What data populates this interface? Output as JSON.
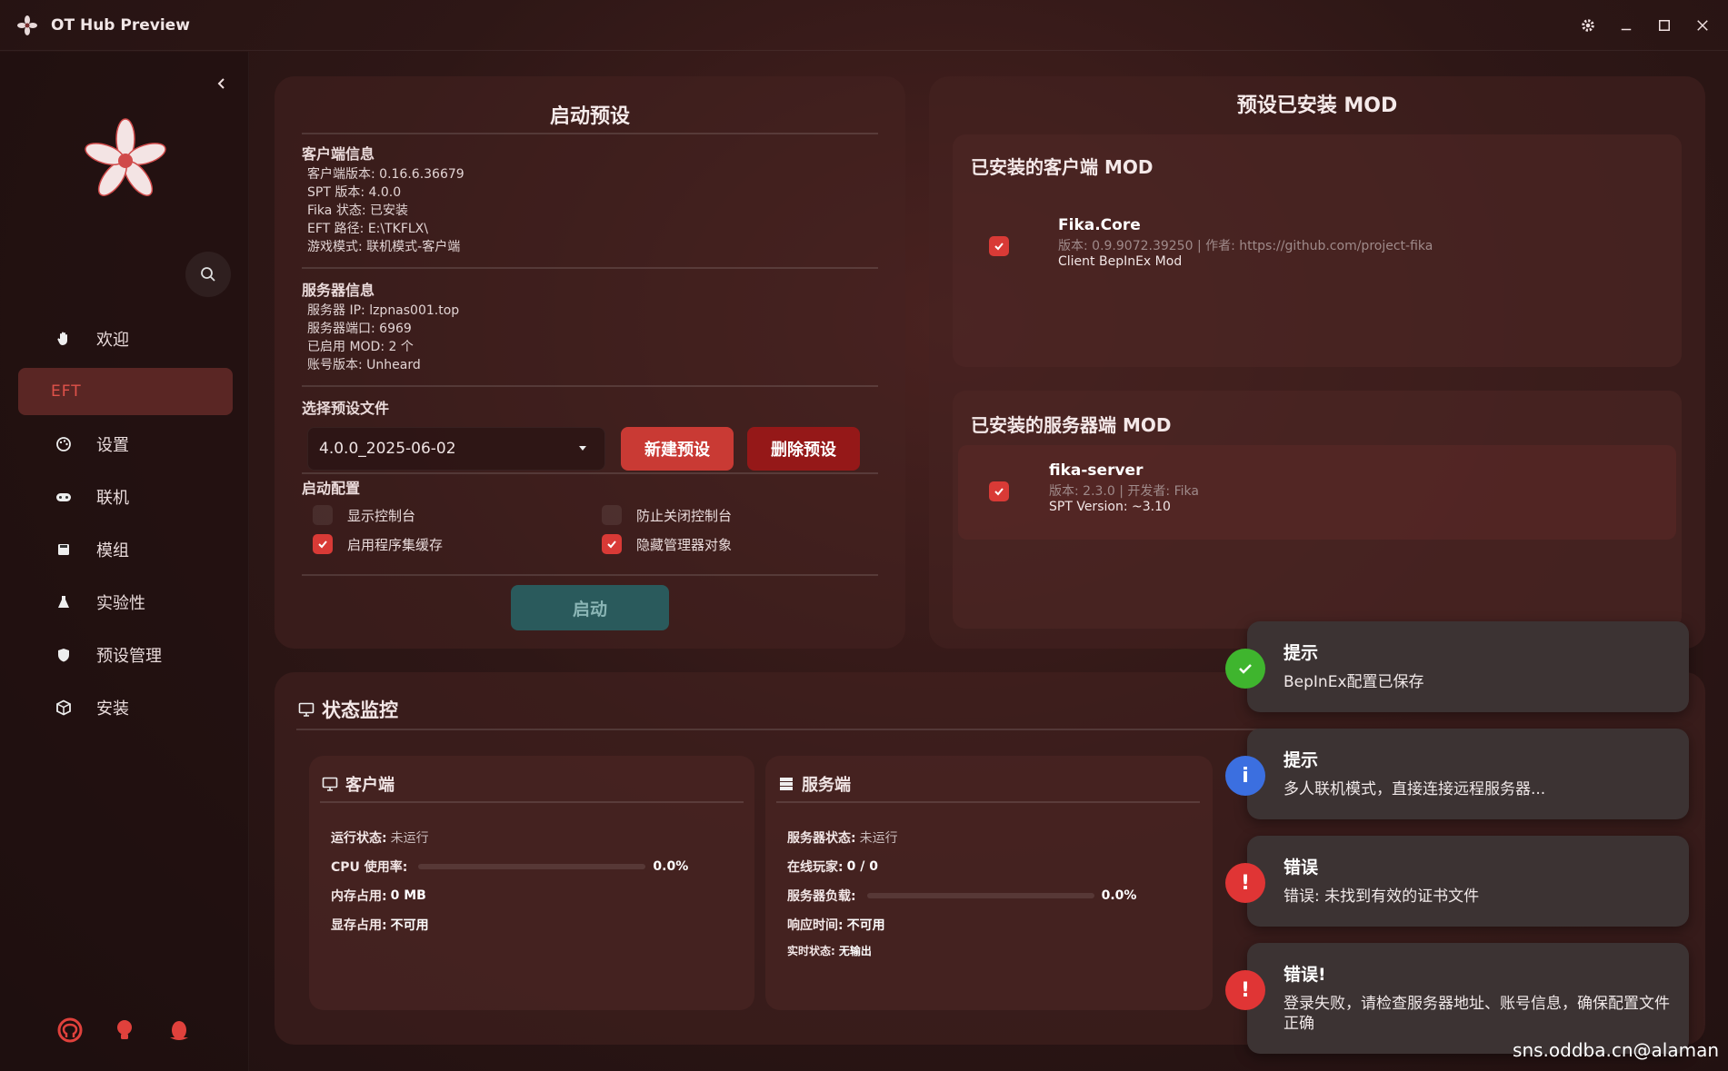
{
  "window": {
    "title": "OT Hub Preview"
  },
  "sidebar": {
    "items": [
      {
        "label": "欢迎",
        "icon": "hand-icon"
      },
      {
        "label": "EFT",
        "icon": "",
        "active": true
      },
      {
        "label": "设置",
        "icon": "palette-icon"
      },
      {
        "label": "联机",
        "icon": "gamepad-icon"
      },
      {
        "label": "模组",
        "icon": "save-icon"
      },
      {
        "label": "实验性",
        "icon": "flask-icon"
      },
      {
        "label": "预设管理",
        "icon": "shield-icon"
      },
      {
        "label": "安装",
        "icon": "box-icon"
      }
    ]
  },
  "launch": {
    "title": "启动预设",
    "client_info_title": "客户端信息",
    "client_info": [
      "客户端版本: 0.16.6.36679",
      "SPT 版本: 4.0.0",
      "Fika 状态: 已安装",
      "EFT 路径: E:\\TKFLX\\",
      "游戏模式: 联机模式-客户端"
    ],
    "server_info_title": "服务器信息",
    "server_info": [
      "服务器 IP: lzpnas001.top",
      "服务器端口: 6969",
      "已启用 MOD: 2 个",
      "账号版本: Unheard"
    ],
    "preset_title": "选择预设文件",
    "preset_value": "4.0.0_2025-06-02",
    "new_preset": "新建预设",
    "delete_preset": "删除预设",
    "config_title": "启动配置",
    "options": [
      {
        "label": "显示控制台",
        "checked": false
      },
      {
        "label": "防止关闭控制台",
        "checked": false
      },
      {
        "label": "启用程序集缓存",
        "checked": true
      },
      {
        "label": "隐藏管理器对象",
        "checked": true
      }
    ],
    "start": "启动"
  },
  "mods": {
    "title": "预设已安装 MOD",
    "client_title": "已安装的客户端 MOD",
    "client_mod": {
      "name": "Fika.Core",
      "meta": "版本: 0.9.9072.39250 | 作者: https://github.com/project-fika",
      "desc": "Client BepInEx Mod"
    },
    "server_title": "已安装的服务器端 MOD",
    "server_mod": {
      "name": "fika-server",
      "meta": "版本: 2.3.0 | 开发者: Fika",
      "desc": "SPT Version: ~3.10"
    }
  },
  "status": {
    "title": "状态监控",
    "client": {
      "title": "客户端",
      "run_label": "运行状态:",
      "run_value": "未运行",
      "cpu_label": "CPU 使用率:",
      "cpu_value": "0.0%",
      "cpu_fraction": 0.0,
      "mem_label": "内存占用:",
      "mem_value": "0 MB",
      "vram_label": "显存占用:",
      "vram_value": "不可用"
    },
    "server": {
      "title": "服务端",
      "state_label": "服务器状态:",
      "state_value": "未运行",
      "players_label": "在线玩家:",
      "players_value": "0 / 0",
      "load_label": "服务器负载:",
      "load_value": "0.0%",
      "load_fraction": 0.0,
      "resp_label": "响应时间:",
      "resp_value": "不可用",
      "live_label": "实时状态:",
      "live_value": "无输出"
    }
  },
  "toasts": [
    {
      "title": "提示",
      "message": "BepInEx配置已保存",
      "kind": "success",
      "color": "#3fb52e"
    },
    {
      "title": "提示",
      "message": "多人联机模式，直接连接远程服务器...",
      "kind": "info",
      "color": "#3b6fe0"
    },
    {
      "title": "错误",
      "message": "错误: 未找到有效的证书文件",
      "kind": "error",
      "color": "#e03535"
    },
    {
      "title": "错误!",
      "message": "登录失败，请检查服务器地址、账号信息，确保配置文件正确",
      "kind": "error",
      "color": "#e03535"
    }
  ],
  "watermark": "sns.oddba.cn@alaman",
  "colors": {
    "accent": "#d93a36",
    "delete": "#951818",
    "start": "#2a5a5c"
  }
}
